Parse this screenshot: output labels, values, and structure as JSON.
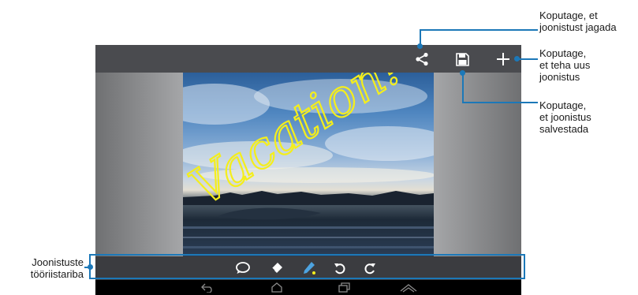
{
  "toolbar": {
    "tools": [
      {
        "name": "text-bubble",
        "icon": "speech-bubble-icon"
      },
      {
        "name": "eraser",
        "icon": "eraser-icon"
      },
      {
        "name": "pen",
        "icon": "pen-icon"
      },
      {
        "name": "undo",
        "icon": "undo-icon"
      },
      {
        "name": "redo",
        "icon": "redo-icon"
      }
    ]
  },
  "action_bar": {
    "buttons": [
      {
        "name": "share",
        "icon": "share-icon"
      },
      {
        "name": "save",
        "icon": "save-icon"
      },
      {
        "name": "new",
        "icon": "plus-icon"
      }
    ]
  },
  "canvas": {
    "handwriting": "Vacation!"
  },
  "callouts": {
    "share": "Koputage, et\njoonistust jagada",
    "new": "Koputage,\net teha uus\njoonistus",
    "save": "Koputage,\net joonistus\nsalvestada",
    "toolbar": "Joonistuste\ntööriistariba"
  },
  "colors": {
    "accent": "#1c78b8",
    "handwriting": "#f4ee1c",
    "action_bar": "#4a4b4f",
    "toolbar": "#3b3c40"
  }
}
